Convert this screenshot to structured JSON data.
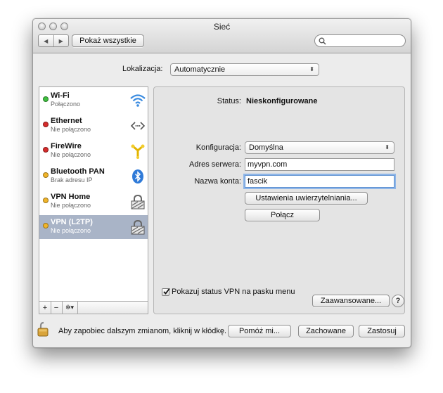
{
  "window": {
    "title": "Sieć",
    "show_all_label": "Pokaż wszystkie",
    "search_placeholder": ""
  },
  "location": {
    "label": "Lokalizacja:",
    "value": "Automatycznie"
  },
  "services": [
    {
      "name": "Wi-Fi",
      "status": "Połączono",
      "status_color": "#3fbf3f",
      "icon": "wifi-icon"
    },
    {
      "name": "Ethernet",
      "status": "Nie połączono",
      "status_color": "#d52b2b",
      "icon": "ethernet-icon"
    },
    {
      "name": "FireWire",
      "status": "Nie połączono",
      "status_color": "#d52b2b",
      "icon": "firewire-icon"
    },
    {
      "name": "Bluetooth PAN",
      "status": "Brak adresu IP",
      "status_color": "#f0b429",
      "icon": "bluetooth-icon"
    },
    {
      "name": "VPN Home",
      "status": "Nie połączono",
      "status_color": "#f0b429",
      "icon": "vpn-lock-icon"
    },
    {
      "name": "VPN (L2TP)",
      "status": "Nie połączono",
      "status_color": "#f0b429",
      "icon": "vpn-lock-icon",
      "selected": true
    }
  ],
  "sidebar_controls": {
    "add": "+",
    "remove": "−",
    "gear": "✲▾"
  },
  "detail": {
    "status_label": "Status:",
    "status_value": "Nieskonfigurowane",
    "config_label": "Konfiguracja:",
    "config_value": "Domyślna",
    "server_label": "Adres serwera:",
    "server_value": "myvpn.com",
    "account_label": "Nazwa konta:",
    "account_value": "fascik",
    "auth_settings_button": "Ustawienia uwierzytelniania...",
    "connect_button": "Połącz",
    "show_status_checkbox": "Pokazuj status VPN na pasku menu",
    "show_status_checked": true,
    "advanced_button": "Zaawansowane...",
    "help_button": "?"
  },
  "footer": {
    "lock_text": "Aby zapobiec dalszym zmianom, kliknij w kłódkę.",
    "assist_button": "Pomóż mi...",
    "revert_button": "Zachowane",
    "apply_button": "Zastosuj"
  },
  "colors": {
    "selection": "#a9b4c7",
    "focus_ring": "#8fb6e8"
  }
}
